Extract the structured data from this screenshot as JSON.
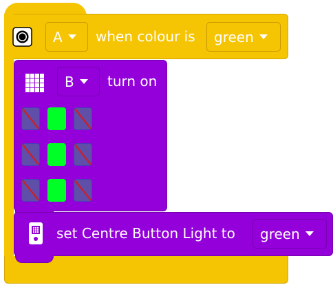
{
  "event_block": {
    "hub": "A",
    "label": "when colour is",
    "colour": "green"
  },
  "matrix_block": {
    "port": "B",
    "label": "turn on",
    "grid": [
      [
        "off",
        "on",
        "off"
      ],
      [
        "off",
        "on",
        "off"
      ],
      [
        "off",
        "on",
        "off"
      ]
    ]
  },
  "centre_light_block": {
    "label": "set Centre Button Light to",
    "colour": "green"
  },
  "colors": {
    "event_yellow": "#f5c402",
    "display_purple": "#9400d9",
    "pixel_on": "#00ff26",
    "pixel_off": "#5f4fa8",
    "pixel_off_slash": "#c8202c"
  },
  "icons": {
    "event": "colour-sensor-icon",
    "matrix": "light-matrix-icon",
    "hub": "hub-icon"
  }
}
